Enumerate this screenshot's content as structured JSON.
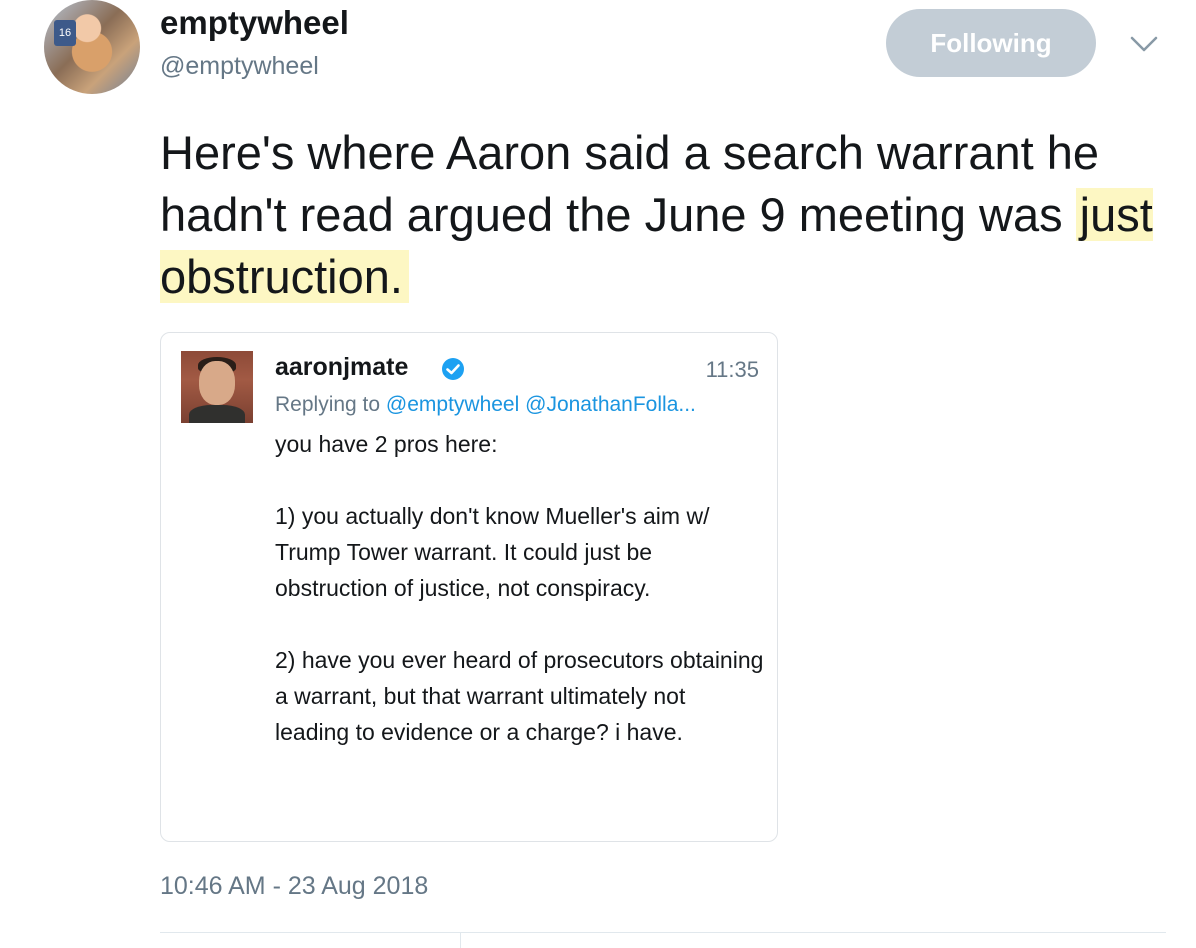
{
  "author": {
    "display_name": "emptywheel",
    "handle": "@emptywheel",
    "avatar_badge": "16"
  },
  "follow_button": {
    "label": "Following"
  },
  "tweet": {
    "text_before": "Here's where Aaron said a search warrant he hadn't read argued the June 9 meeting was ",
    "text_highlight": "just obstruction.",
    "highlight_color": "#fdf7c3"
  },
  "quoted": {
    "display_name": "aaronjmate",
    "time": "11:35",
    "replying_prefix": "Replying to ",
    "mention_1": "@emptywheel",
    "mention_2": "@JonathanFolla...",
    "paragraphs": [
      "you have 2 pros here:",
      "1) you actually don't know Mueller's aim w/ Trump Tower warrant. It could just be obstruction of justice, not conspiracy.",
      "2) have you ever heard of prosecutors obtaining a warrant, but that warrant ultimately not leading to evidence or a charge? i have."
    ]
  },
  "timestamp": "10:46 AM - 23 Aug 2018",
  "colors": {
    "text_primary": "#14171a",
    "text_secondary": "#657786",
    "link": "#1b95e0",
    "follow_button_bg": "#c3cdd6"
  }
}
